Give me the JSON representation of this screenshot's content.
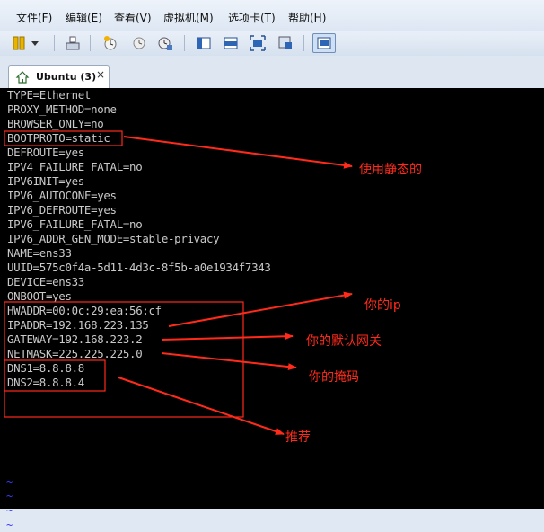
{
  "menu": [
    "文件(F)",
    "编辑(E)",
    "查看(V)",
    "虚拟机(M)",
    "选项卡(T)",
    "帮助(H)"
  ],
  "toolbar": {
    "icons": [
      "pause-icon",
      "dropdown-arrow-icon",
      "send-keys-icon",
      "snapshot-icon",
      "revert-snapshot-icon",
      "snapshot-manager-icon",
      "sidebar-view-icon",
      "console-view-icon",
      "fullscreen-icon",
      "unity-icon",
      "thumbnail-view-icon"
    ]
  },
  "tab": {
    "label": "Ubuntu (3)",
    "close": "×"
  },
  "terminal": {
    "lines": [
      "TYPE=Ethernet",
      "PROXY_METHOD=none",
      "BROWSER_ONLY=no",
      "BOOTPROTO=static",
      "DEFROUTE=yes",
      "IPV4_FAILURE_FATAL=no",
      "IPV6INIT=yes",
      "IPV6_AUTOCONF=yes",
      "IPV6_DEFROUTE=yes",
      "IPV6_FAILURE_FATAL=no",
      "IPV6_ADDR_GEN_MODE=stable-privacy",
      "NAME=ens33",
      "UUID=575c0f4a-5d11-4d3c-8f5b-a0e1934f7343",
      "DEVICE=ens33",
      "ONBOOT=yes",
      "HWADDR=00:0c:29:ea:56:cf",
      "IPADDR=192.168.223.135",
      "GATEWAY=192.168.223.2",
      "NETMASK=225.225.225.0",
      "DNS1=8.8.8.8",
      "DNS2=8.8.8.4"
    ],
    "tildes": [
      "~",
      "~",
      "~",
      "~"
    ]
  },
  "annotations": {
    "static": "使用静态的",
    "ip": "你的ip",
    "gateway": "你的默认网关",
    "netmask": "你的掩码",
    "dns": "推荐"
  },
  "colors": {
    "annotation": "#ff2a1a",
    "terminal_bg": "#000000",
    "terminal_text": "#c9c9c9",
    "tilde": "#3a3aff"
  }
}
